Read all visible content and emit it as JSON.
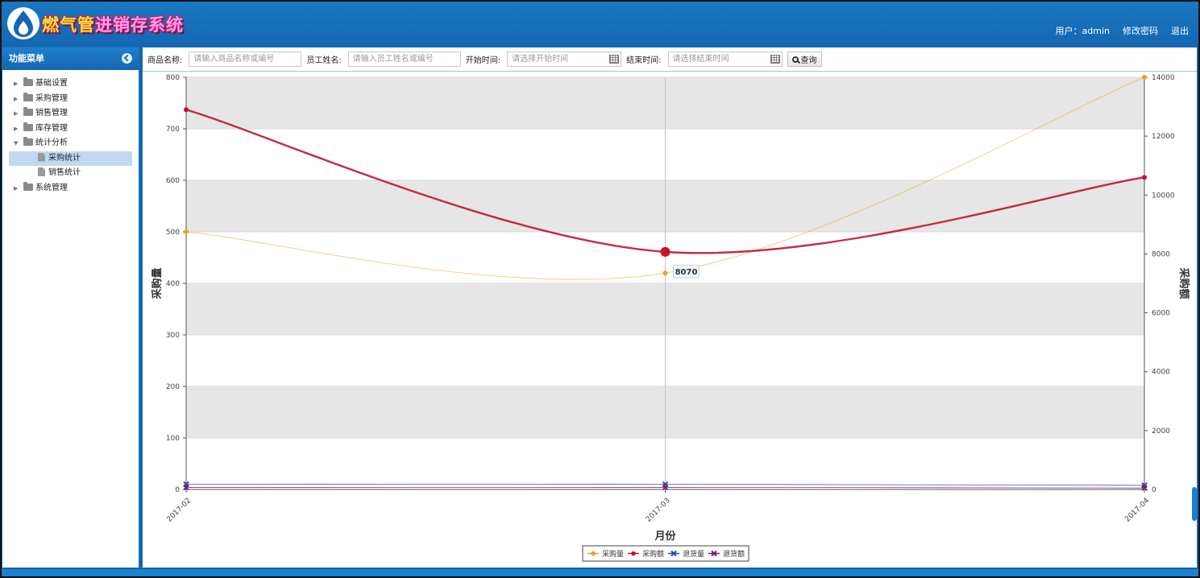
{
  "header": {
    "brand_part1": "燃气管",
    "brand_part2": "进销存系统",
    "user_label": "用户：admin",
    "change_password": "修改密码",
    "logout": "退出"
  },
  "sidebar": {
    "title": "功能菜单",
    "items": [
      {
        "label": "基础设置"
      },
      {
        "label": "采购管理"
      },
      {
        "label": "销售管理"
      },
      {
        "label": "库存管理"
      },
      {
        "label": "统计分析",
        "children": [
          {
            "label": "采购统计"
          },
          {
            "label": "销售统计"
          }
        ]
      },
      {
        "label": "系统管理"
      }
    ]
  },
  "toolbar": {
    "product_label": "商品名称:",
    "product_placeholder": "请输入商品名称或编号",
    "employee_label": "员工姓名:",
    "employee_placeholder": "请输入员工姓名或编号",
    "start_label": "开始时间:",
    "start_placeholder": "请选择开始时间",
    "end_label": "结束时间:",
    "end_placeholder": "请选择结束时间",
    "search_label": "查询"
  },
  "chart_data": {
    "type": "line",
    "categories": [
      "2017-02",
      "2017-03",
      "2017-04"
    ],
    "xlabel": "月份",
    "ylabel_left": "采购量",
    "ylabel_right": "采购额",
    "ylim_left": [
      0,
      800
    ],
    "ylim_right": [
      0,
      14000
    ],
    "yticks_left": [
      0,
      100,
      200,
      300,
      400,
      500,
      600,
      700,
      800
    ],
    "yticks_right": [
      0,
      2000,
      4000,
      6000,
      8000,
      10000,
      12000,
      14000
    ],
    "series": [
      {
        "name": "采购量",
        "axis": "left",
        "color": "#f0a020",
        "values": [
          500,
          420,
          800
        ]
      },
      {
        "name": "采购额",
        "axis": "right",
        "color": "#c0142a",
        "values": [
          12900,
          8070,
          10600
        ]
      },
      {
        "name": "退货量",
        "axis": "left",
        "color": "#2a4aa8",
        "values": [
          10,
          10,
          8
        ]
      },
      {
        "name": "退货额",
        "axis": "right",
        "color": "#7a1a6a",
        "values": [
          70,
          70,
          50
        ]
      }
    ],
    "tooltip": {
      "text": "8070"
    },
    "grid": true,
    "legend": "bottom-center"
  }
}
